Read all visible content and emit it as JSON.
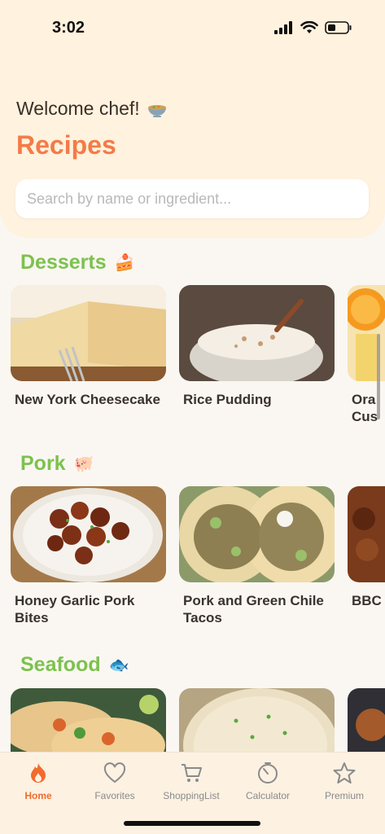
{
  "status": {
    "time": "3:02"
  },
  "header": {
    "welcome": "Welcome chef!",
    "welcome_icon": "soup-bowl-icon",
    "title": "Recipes"
  },
  "search": {
    "placeholder": "Search by name or ingredient...",
    "value": ""
  },
  "sections": [
    {
      "title": "Desserts",
      "emoji": "🍰",
      "items": [
        {
          "name": "New York Cheesecake"
        },
        {
          "name": "Rice Pudding"
        },
        {
          "name": "Ora\nCus"
        }
      ]
    },
    {
      "title": "Pork",
      "emoji": "🐖",
      "items": [
        {
          "name": "Honey Garlic Pork\nBites"
        },
        {
          "name": "Pork and Green Chile\nTacos"
        },
        {
          "name": "BBC"
        }
      ]
    },
    {
      "title": "Seafood",
      "emoji": "🐟",
      "items": [
        {
          "name": ""
        },
        {
          "name": ""
        },
        {
          "name": ""
        }
      ]
    }
  ],
  "tabs": [
    {
      "label": "Home",
      "icon": "flame-icon",
      "active": true
    },
    {
      "label": "Favorites",
      "icon": "heart-icon",
      "active": false
    },
    {
      "label": "ShoppingList",
      "icon": "cart-icon",
      "active": false
    },
    {
      "label": "Calculator",
      "icon": "timer-icon",
      "active": false
    },
    {
      "label": "Premium",
      "icon": "star-icon",
      "active": false
    }
  ],
  "colors": {
    "accent": "#f47b48",
    "section": "#7cc24d",
    "header_bg": "#fff2de",
    "active_tab": "#f26b2c"
  }
}
